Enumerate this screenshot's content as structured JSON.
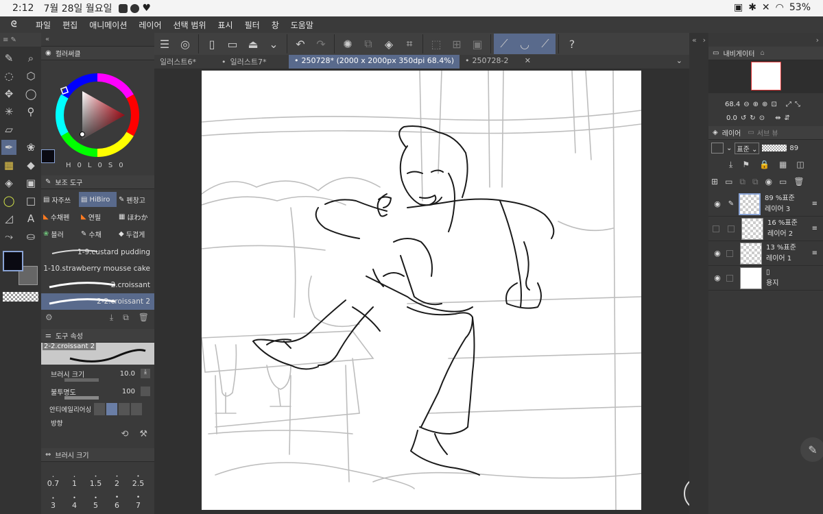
{
  "status_bar": {
    "time": "2:12",
    "date": "7월 28일 월요일",
    "battery": "53%"
  },
  "menu": {
    "items": [
      "파일",
      "편집",
      "애니메이션",
      "레이어",
      "선택 범위",
      "표시",
      "필터",
      "창",
      "도움말"
    ]
  },
  "tabs": [
    {
      "label": "일러스트6*",
      "active": false
    },
    {
      "label": "일러스트7*",
      "active": false
    },
    {
      "label": "250728* (2000 x 2000px 350dpi 68.4%)",
      "active": true
    },
    {
      "label": "250728-2",
      "active": false
    }
  ],
  "color_wheel": {
    "title": "컬러써클",
    "hsv_labels": [
      "H",
      "0",
      "L",
      "0",
      "S",
      "0"
    ]
  },
  "sub_tool": {
    "title": "보조 도구",
    "tools": [
      {
        "label": "자주쓰",
        "selected": false
      },
      {
        "label": "HiBiro",
        "selected": true
      },
      {
        "label": "펜창고",
        "selected": false
      },
      {
        "label": "수채펜",
        "selected": false
      },
      {
        "label": "연필",
        "selected": false
      },
      {
        "label": "ほわか",
        "selected": false
      },
      {
        "label": "블러",
        "selected": false
      },
      {
        "label": "수채",
        "selected": false
      },
      {
        "label": "두겹게",
        "selected": false
      }
    ],
    "brushes": [
      {
        "label": "1-9.custard pudding",
        "selected": false
      },
      {
        "label": "1-10.strawberry mousse cake",
        "selected": false
      },
      {
        "label": "2.croissant",
        "selected": false
      },
      {
        "label": "2-2.croissant 2",
        "selected": true
      }
    ]
  },
  "tool_property": {
    "title": "도구 속성",
    "brush_name": "2-2.croissant 2",
    "brush_size_label": "브러시 크기",
    "brush_size_value": "10.0",
    "opacity_label": "불투명도",
    "opacity_value": "100",
    "antialias_label": "안티에일리어싱",
    "direction_label": "방향"
  },
  "brush_size_panel": {
    "title": "브러시 크기",
    "sizes_row1": [
      "0.7",
      "1",
      "1.5",
      "2",
      "2.5"
    ],
    "sizes_row2": [
      "3",
      "4",
      "5",
      "6",
      "7"
    ]
  },
  "navigator": {
    "title": "내비게이터",
    "zoom": "68.4",
    "rotation": "0.0"
  },
  "layer_panel": {
    "title": "레이어",
    "sub_tab": "서브 뷰",
    "blend_mode": "표준",
    "opacity": "89",
    "layers": [
      {
        "percent": "89 %표준",
        "name": "레이어 3",
        "visible": true,
        "selected": true
      },
      {
        "percent": "16 %표준",
        "name": "레이어 2",
        "visible": false,
        "selected": false
      },
      {
        "percent": "13 %표준",
        "name": "레이어 1",
        "visible": true,
        "selected": false
      },
      {
        "percent": "",
        "name": "용지",
        "visible": true,
        "selected": false
      }
    ]
  }
}
